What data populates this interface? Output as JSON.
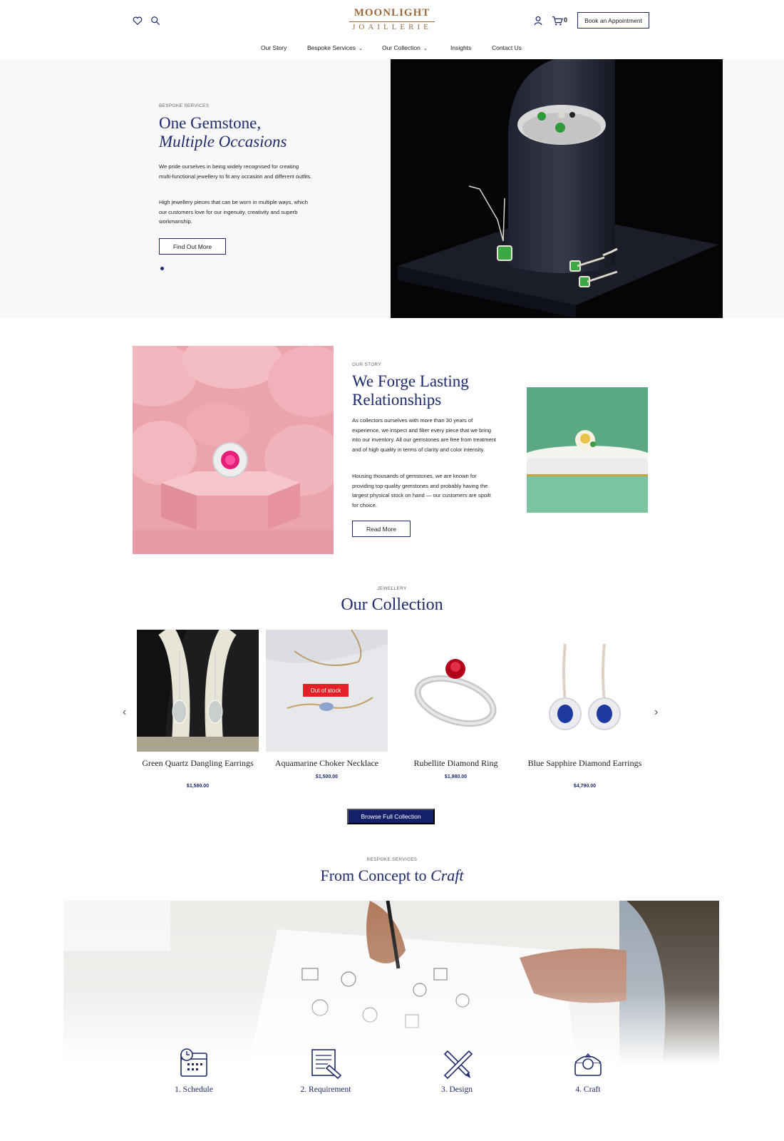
{
  "header": {
    "logo_top": "MOONLIGHT",
    "logo_bottom": "JOAILLERIE",
    "cart_count": "0",
    "appointment_label": "Book an Appointment"
  },
  "nav": [
    {
      "label": "Our Story"
    },
    {
      "label": "Bespoke Services",
      "has_dropdown": true
    },
    {
      "label": "Our Collection",
      "has_dropdown": true
    },
    {
      "label": "Insights"
    },
    {
      "label": "Contact Us"
    }
  ],
  "hero": {
    "eyebrow": "BESPOKE SERVICES",
    "title_line1": "One Gemstone,",
    "title_line2": "Multiple Occasions",
    "para1": "We pride ourselves in being widely recognised for creating multi-functional jewellery to fit any occasion and different outfits.",
    "para2": "High jewellery pieces that can be worn in multiple ways, which our customers love for our ingenuity, creativity and superb workmanship.",
    "button": "Find Out More"
  },
  "story": {
    "eyebrow": "OUR STORY",
    "title_line1": "We Forge Lasting",
    "title_line2": "Relationships",
    "para1": "As collectors ourselves with more than 30 years of experience, we inspect and filter every piece that we bring into our inventory. All our gemstones are free from treatment and of high quality in terms of clarity and color intensity.",
    "para2": "Housing thousands of gemstones, we are known for providing top-quality gemstones and probably having the largest physical stock on hand — our customers are spoilt for choice.",
    "button": "Read More"
  },
  "collection": {
    "eyebrow": "JEWELLERY",
    "title": "Our Collection",
    "products": [
      {
        "name": "Green Quartz Dangling Earrings",
        "price": "$1,580.00"
      },
      {
        "name": "Aquamarine Choker Necklace",
        "price": "$1,500.00",
        "badge": "Out of stock"
      },
      {
        "name": "Rubellite Diamond Ring",
        "price": "$1,980.00"
      },
      {
        "name": "Blue Sapphire Diamond Earrings",
        "price": "$4,790.00"
      }
    ],
    "browse_button": "Browse Full Collection"
  },
  "bespoke": {
    "eyebrow": "BESPOKE SERVICES",
    "title_plain": "From Concept to",
    "title_italic": "Craft",
    "steps": [
      {
        "label": "1. Schedule",
        "icon": "calendar-clock-icon"
      },
      {
        "label": "2. Requirement",
        "icon": "document-pen-icon"
      },
      {
        "label": "3. Design",
        "icon": "pencil-ruler-icon"
      },
      {
        "label": "4. Craft",
        "icon": "ring-box-icon"
      }
    ]
  },
  "colors": {
    "navy": "#1e2a6b",
    "button_navy": "#14206a",
    "logo_gold": "#9b6a3a",
    "badge_red": "#e42127",
    "hero_bg": "#f8f8f8"
  }
}
